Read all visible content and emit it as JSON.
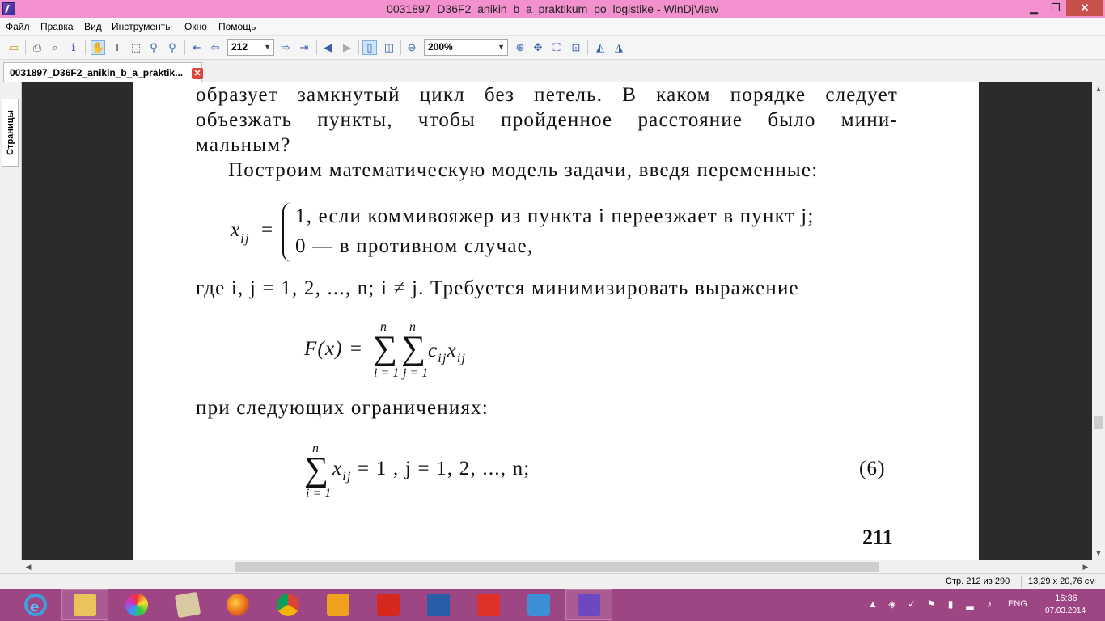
{
  "window": {
    "title": "0031897_D36F2_anikin_b_a_praktikum_po_logistike - WinDjView",
    "controls": {
      "minimize": "▁",
      "maximize": "❐",
      "close": "✕"
    }
  },
  "menu": [
    "Файл",
    "Правка",
    "Вид",
    "Инструменты",
    "Окно",
    "Помощь"
  ],
  "toolbar": {
    "page_number": "212",
    "zoom": "200%",
    "icons": [
      "open-icon",
      "print-icon",
      "find-icon",
      "info-icon",
      "hand-tool-icon",
      "select-text-icon",
      "select-area-icon",
      "zoom-in-tool-icon",
      "zoom-out-tool-icon",
      "first-page-icon",
      "prev-page-icon",
      "next-page-icon",
      "last-page-icon",
      "back-icon",
      "forward-icon",
      "single-page-icon",
      "facing-pages-icon",
      "zoom-out-icon",
      "zoom-in-icon",
      "fit-width-icon",
      "fit-page-icon",
      "actual-size-icon",
      "rotate-left-icon",
      "rotate-right-icon"
    ]
  },
  "tab": {
    "label": "0031897_D36F2_anikin_b_a_praktik...",
    "close": "✕"
  },
  "sidepanel": {
    "pages_tab": "Страницы"
  },
  "page": {
    "line1": "образует замкнутый цикл без петель. В каком порядке следует",
    "line2": "объезжать пункты, чтобы пройденное расстояние было мини-",
    "line3": "мальным?",
    "line4": "Построим математическую модель задачи, введя переменные:",
    "var_x": "x",
    "var_sub": "ij",
    "eq": "=",
    "case1": "1, если коммивояжер из пункта i переезжает в пункт j;",
    "case2": "0 — в противном случае,",
    "where_line": "где i, j = 1, 2, ..., n; i ≠ j. Требуется минимизировать выражение",
    "f_left": "F(x) =",
    "sum1_top": "n",
    "sum1_bot": "i = 1",
    "sum2_top": "n",
    "sum2_bot": "j = 1",
    "sigma": "∑",
    "f_term_c": "c",
    "f_term_sub1": "ij",
    "f_term_x": "x",
    "f_term_sub2": "ij",
    "constraints_line": "при следующих ограничениях:",
    "c6_top": "n",
    "c6_bot": "i = 1",
    "c6_x": "x",
    "c6_sub": "ij",
    "c6_rest": "= 1 ,  j  =  1,  2,  ...,  n;",
    "c6_number": "(6)",
    "page_number": "211"
  },
  "status": {
    "page": "Стр. 212 из 290",
    "size": "13,29 x 20,76 см"
  },
  "taskbar": {
    "apps": [
      "ie-icon",
      "explorer-icon",
      "color-picker-icon",
      "notes-icon",
      "firefox-icon",
      "chrome-icon",
      "media-player-icon",
      "adobe-reader-icon",
      "word-icon",
      "yandex-icon",
      "sound-app-icon",
      "windjview-icon"
    ],
    "lang": "ENG",
    "time": "16:36",
    "date": "07.03.2014"
  }
}
